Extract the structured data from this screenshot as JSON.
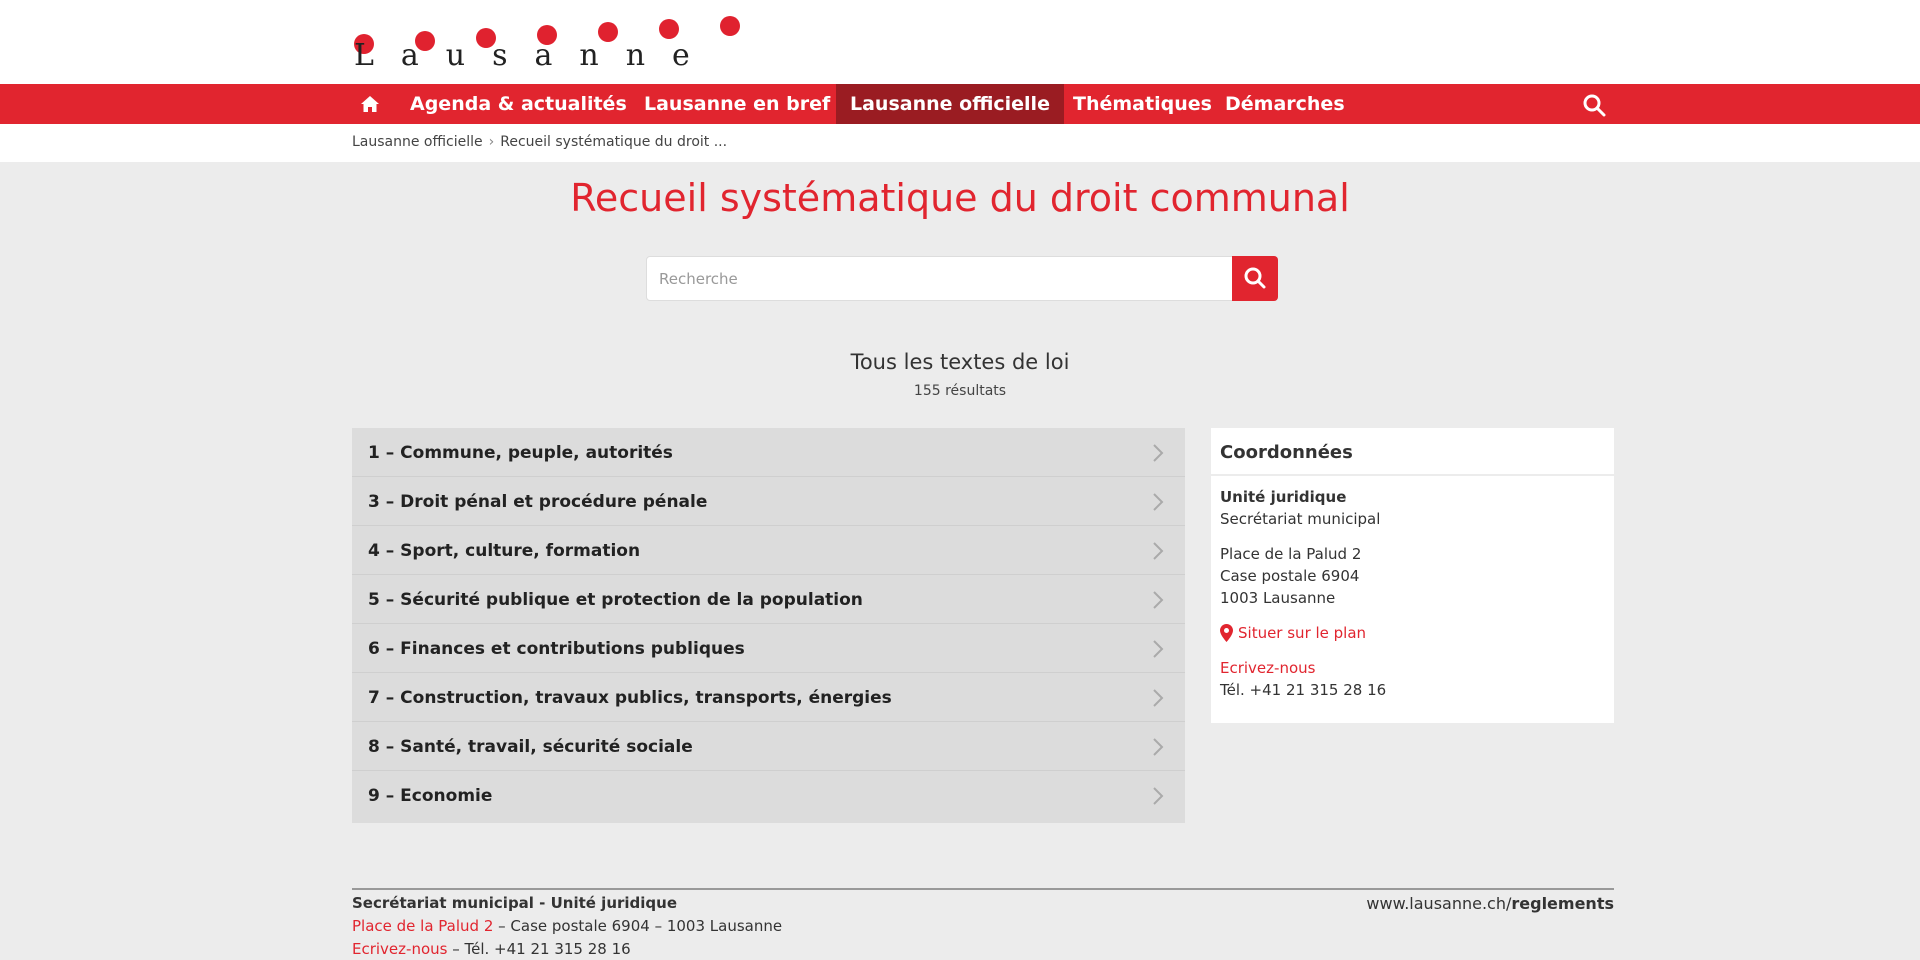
{
  "logo": {
    "text": "Lausanne"
  },
  "nav": {
    "items": [
      {
        "label": "Agenda & actualités",
        "active": false
      },
      {
        "label": "Lausanne en bref",
        "active": false
      },
      {
        "label": "Lausanne officielle",
        "active": true
      },
      {
        "label": "Thématiques",
        "active": false
      },
      {
        "label": "Démarches",
        "active": false
      }
    ],
    "home_icon": "home-icon",
    "search_icon": "search-icon"
  },
  "breadcrumb": {
    "items": [
      "Lausanne officielle",
      "Recueil systématique du droit ..."
    ],
    "separator": "›"
  },
  "page": {
    "title": "Recueil systématique du droit communal"
  },
  "search": {
    "placeholder": "Recherche",
    "button_icon": "search-icon"
  },
  "results": {
    "title": "Tous les textes de loi",
    "count": "155 résultats"
  },
  "categories": [
    "1 – Commune, peuple, autorités",
    "3 – Droit pénal et procédure pénale",
    "4 – Sport, culture, formation",
    "5 – Sécurité publique et protection de la population",
    "6 – Finances et contributions publiques",
    "7 – Construction, travaux publics, transports, énergies",
    "8 – Santé, travail, sécurité sociale",
    "9 – Economie"
  ],
  "contact": {
    "heading": "Coordonnées",
    "unit": "Unité juridique",
    "department": "Secrétariat municipal",
    "address": [
      "Place de la Palud 2",
      "Case postale 6904",
      "1003 Lausanne"
    ],
    "map_link": "Situer sur le plan",
    "write_link": "Ecrivez-nous",
    "phone": "Tél. +41 21 315 28 16"
  },
  "footer": {
    "title": "Secrétariat municipal - Unité juridique",
    "address_link": "Place de la Palud 2",
    "address_rest": " – Case postale 6904 – 1003 Lausanne",
    "write_link": "Ecrivez-nous",
    "phone": " – Tél. +41 21 315 28 16",
    "url_plain": "www.lausanne.ch/",
    "url_bold": "reglements"
  },
  "colors": {
    "brand_red": "#e1252f",
    "active_nav": "#9a1c22",
    "background": "#ececec"
  }
}
